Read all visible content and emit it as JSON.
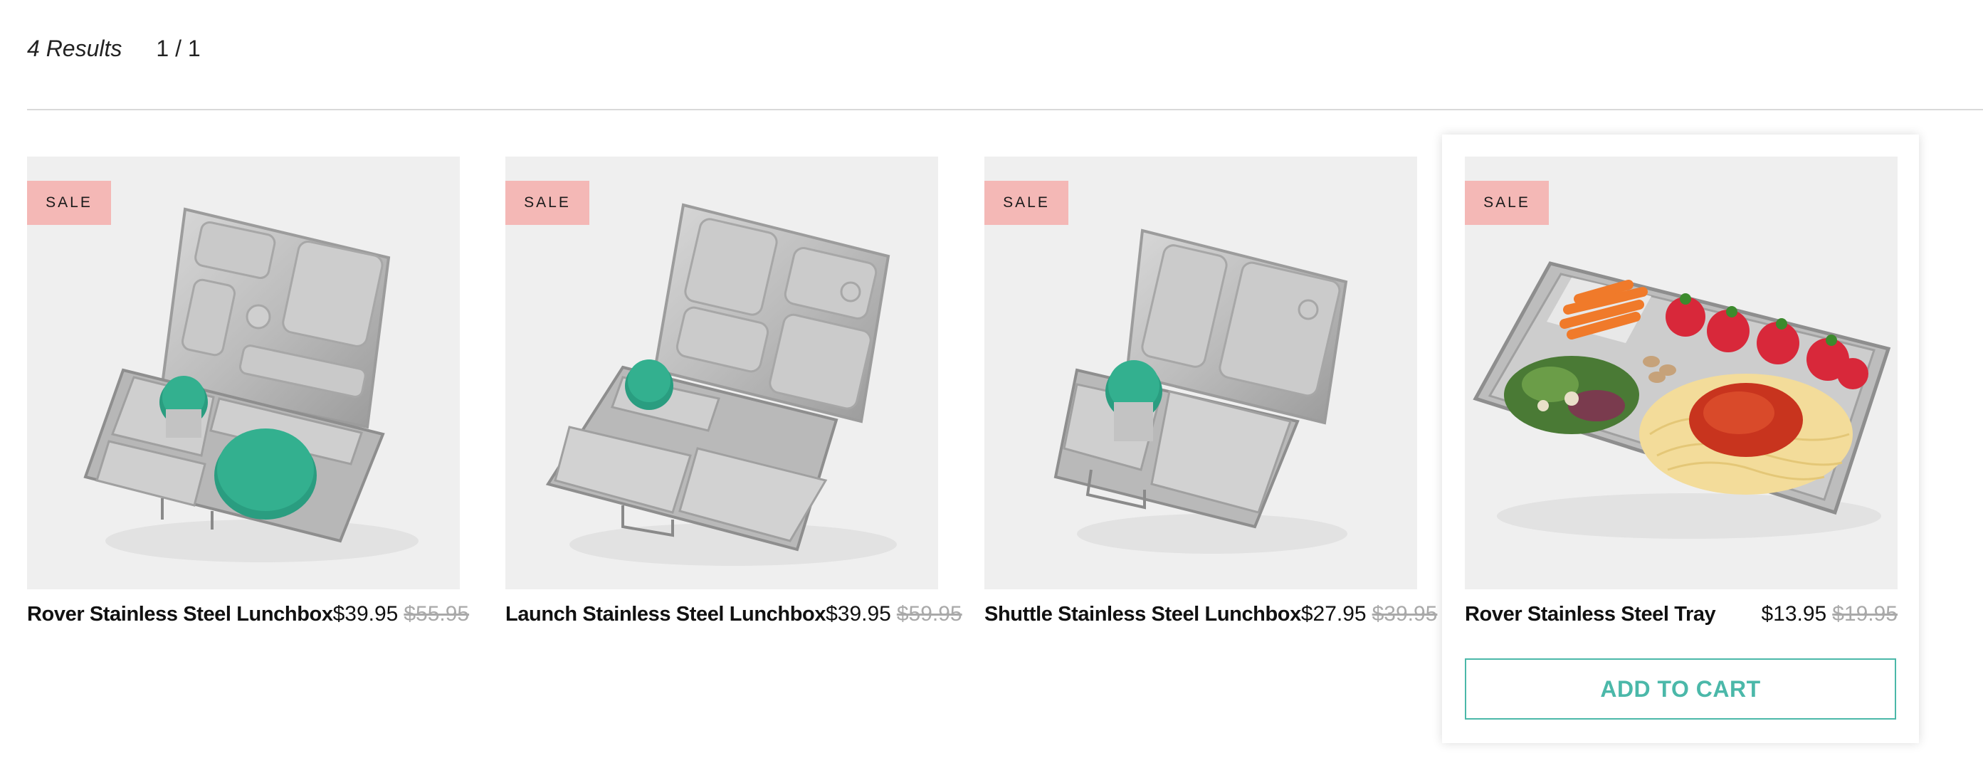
{
  "results": {
    "count_label": "4 Results",
    "pages_label": "1 / 1"
  },
  "colors": {
    "sale_badge": "#f4b8b6",
    "accent_teal": "#4bb8a9",
    "card_background": "#efefef",
    "old_price": "#a9a9a9"
  },
  "products": [
    {
      "name": "Rover Stainless Steel Lunchbox",
      "badge": "SALE",
      "price": "$39.95",
      "original_price": "$55.95",
      "image_icon": "rover-lunchbox-image"
    },
    {
      "name": "Launch Stainless Steel Lunchbox",
      "badge": "SALE",
      "price": "$39.95",
      "original_price": "$59.95",
      "image_icon": "launch-lunchbox-image"
    },
    {
      "name": "Shuttle Stainless Steel Lunchbox",
      "badge": "SALE",
      "price": "$27.95",
      "original_price": "$39.95",
      "image_icon": "shuttle-lunchbox-image"
    },
    {
      "name": "Rover Stainless Steel Tray",
      "badge": "SALE",
      "price": "$13.95",
      "original_price": "$19.95",
      "image_icon": "rover-tray-image"
    }
  ],
  "add_to_cart_label": "ADD TO CART"
}
